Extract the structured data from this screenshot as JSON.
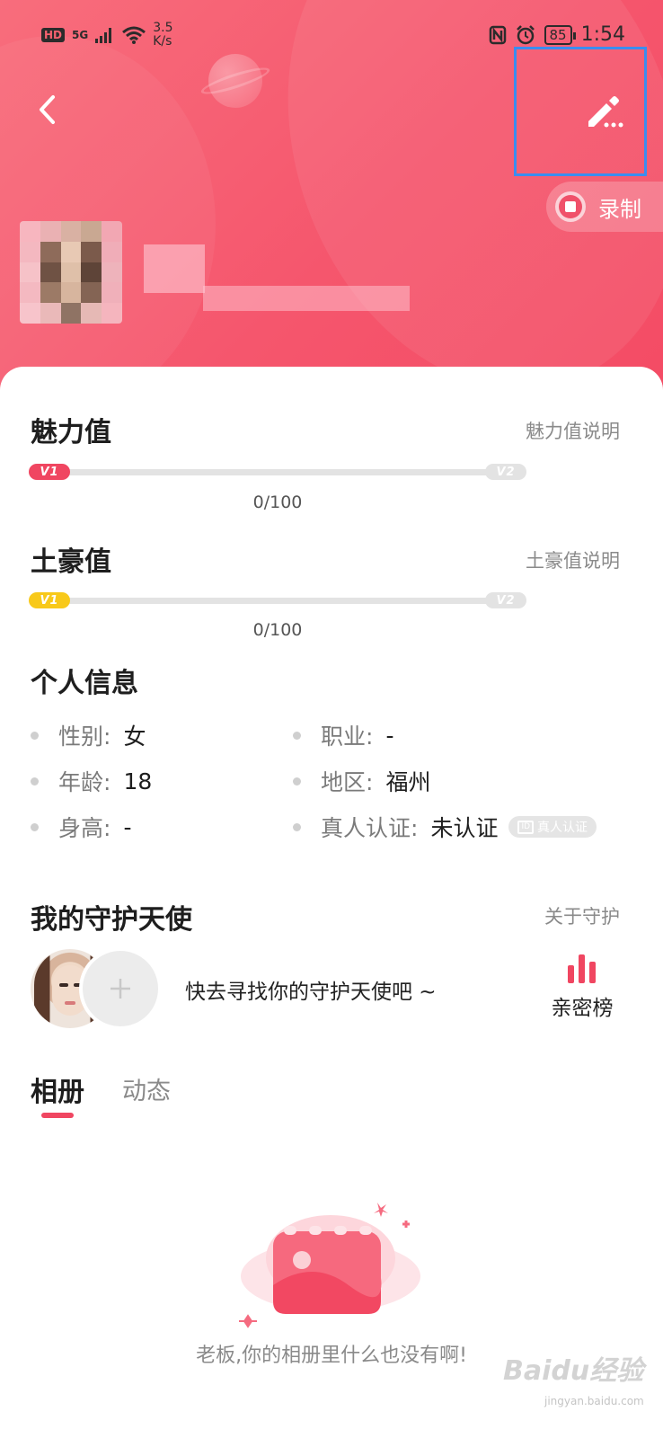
{
  "status_bar": {
    "network_badge": "HD",
    "network_type": "5G",
    "speed_value": "3.5",
    "speed_unit": "K/s",
    "battery": "85",
    "time": "1:54"
  },
  "header": {
    "record_label": "录制"
  },
  "charm": {
    "title": "魅力值",
    "link": "魅力值说明",
    "level_start": "V1",
    "level_end": "V2",
    "progress_text": "0/100",
    "progress_fraction": 0,
    "color": "#f04661"
  },
  "wealth": {
    "title": "土豪值",
    "link": "土豪值说明",
    "level_start": "V1",
    "level_end": "V2",
    "progress_text": "0/100",
    "progress_fraction": 0,
    "color": "#f8c91a"
  },
  "personal_info": {
    "title": "个人信息",
    "gender": {
      "key": "性别:",
      "value": "女"
    },
    "job": {
      "key": "职业:",
      "value": "-"
    },
    "age": {
      "key": "年龄:",
      "value": "18"
    },
    "region": {
      "key": "地区:",
      "value": "福州"
    },
    "height": {
      "key": "身高:",
      "value": "-"
    },
    "verification": {
      "key": "真人认证:",
      "value": "未认证",
      "badge": "真人认证"
    }
  },
  "guardian": {
    "title": "我的守护天使",
    "link": "关于守护",
    "hint": "快去寻找你的守护天使吧 ~",
    "rank_label": "亲密榜"
  },
  "tabs": {
    "album": "相册",
    "moments": "动态",
    "active": "album"
  },
  "album": {
    "empty_text": "老板,你的相册里什么也没有啊!"
  },
  "watermark": {
    "brand": "Baidu经验",
    "url": "jingyan.baidu.com"
  },
  "colors": {
    "brand": "#f5566d",
    "accent": "#f04661",
    "highlight_box": "#3a8df0"
  },
  "icons": {
    "back": "chevron-left-icon",
    "edit": "pencil-icon",
    "record": "stop-icon",
    "add": "plus-icon",
    "rank": "bar-chart-icon",
    "empty": "photo-album-icon"
  }
}
